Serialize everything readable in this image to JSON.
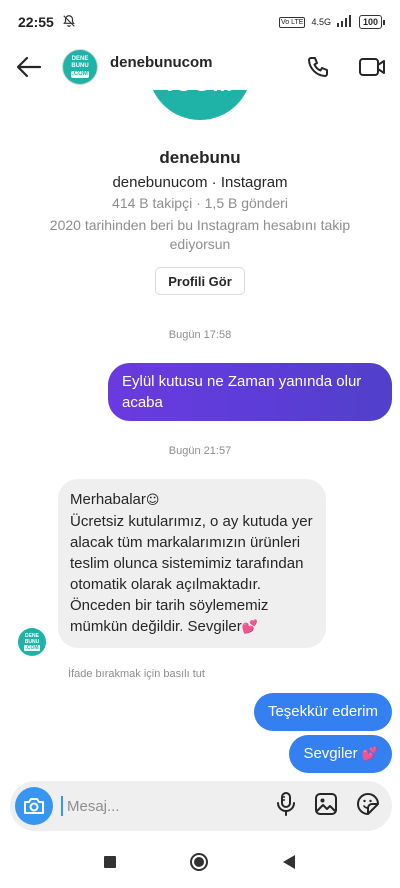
{
  "status": {
    "time": "22:55",
    "network": "4.5G",
    "volte": "Vo LTE",
    "battery": "100"
  },
  "header": {
    "username": "denebunucom",
    "avatar_text": [
      "DENE",
      "BUNU",
      ".COM"
    ]
  },
  "profile": {
    "logo_text": ".COM",
    "name": "denebunu",
    "handle_line": "denebunucom · Instagram",
    "stats": "414 B takipçi · 1,5 B gönderi",
    "since": "2020 tarihinden beri bu Instagram hesabını takip ediyorsun",
    "view_button": "Profili Gör"
  },
  "conversation": {
    "timestamp_1": "Bugün 17:58",
    "msg_out_1": "Eylül kutusu ne Zaman yanında olur acaba",
    "timestamp_2": "Bugün 21:57",
    "msg_in_1_greeting": "Merhabalar",
    "msg_in_1_body": "Ücretsiz kutularımız, o ay kutuda yer alacak tüm markalarımızın ürünleri teslim olunca sistemimiz tarafından otomatik olarak açılmaktadır. Önceden bir tarih söylememiz mümkün değildir. Sevgiler",
    "reaction_hint": "İfade bırakmak için basılı tut",
    "msg_out_2": "Teşekkür ederim",
    "msg_out_3": "Sevgiler"
  },
  "composer": {
    "placeholder": "Mesaj..."
  },
  "icons": {
    "back": "arrow-left-icon",
    "call": "phone-icon",
    "video": "video-camera-icon",
    "camera": "camera-icon",
    "mic": "microphone-icon",
    "gallery": "image-icon",
    "sticker": "sticker-icon",
    "nav_recents": "square-icon",
    "nav_home": "circle-icon",
    "nav_back": "triangle-back-icon"
  },
  "colors": {
    "accent_blue": "#3797f0",
    "brand_teal": "#1fb3a8",
    "outgoing_gradient_start": "#6a3ae0",
    "outgoing_blue": "#3580f0"
  }
}
